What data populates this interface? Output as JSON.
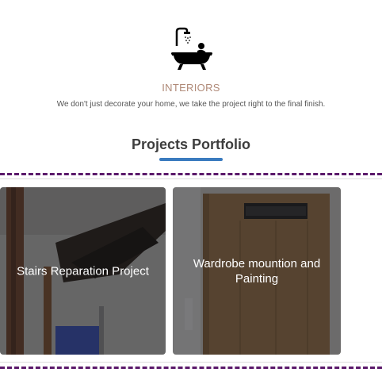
{
  "brand": {
    "logo_icon": "bathtub-shower-icon",
    "category": "INTERIORS",
    "tagline": "We don't just decorate your home, we take the project right to the final finish.",
    "category_color": "#b08a78"
  },
  "portfolio": {
    "title": "Projects Portfolio",
    "underline_color": "#3a7bbf",
    "divider_color": "#5b1a6b",
    "projects": [
      {
        "label": "Stairs Reparation Project"
      },
      {
        "label": "Wardrobe mountion and Painting"
      }
    ]
  }
}
